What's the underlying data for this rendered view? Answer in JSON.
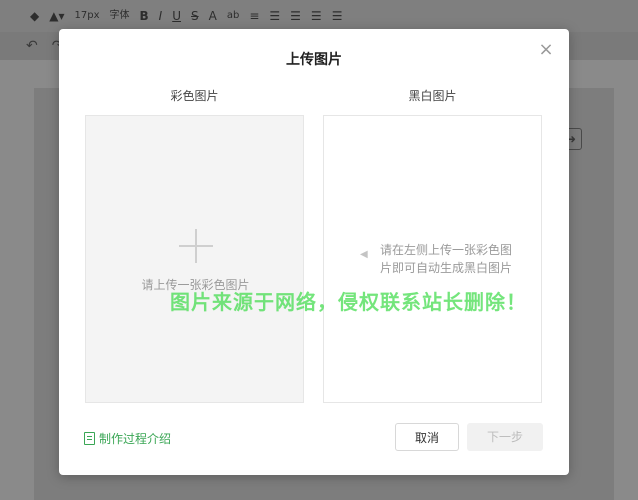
{
  "toolbar": {
    "font_size": "17px",
    "font_family": "字体",
    "bold": "B",
    "italic": "I",
    "underline": "U",
    "strike": "S",
    "font_color": "A",
    "bg_label": "ab"
  },
  "modal": {
    "title": "上传图片",
    "close": "×",
    "color_panel": {
      "label": "彩色图片",
      "upload_text": "请上传一张彩色图片"
    },
    "bw_panel": {
      "label": "黑白图片",
      "hint": "请在左侧上传一张彩色图片即可自动生成黑白图片"
    },
    "link": "制作过程介绍",
    "cancel": "取消",
    "next": "下一步"
  },
  "watermark": "图片来源于网络，侵权联系站长删除！",
  "colors": {
    "accent": "#3aa655",
    "overlay": "#8a8a8a",
    "disabled_text": "#bdbdbd"
  },
  "icons": {
    "close": "close-icon",
    "plus": "plus-icon",
    "arrow": "arrow-left-icon",
    "doc": "document-icon"
  }
}
